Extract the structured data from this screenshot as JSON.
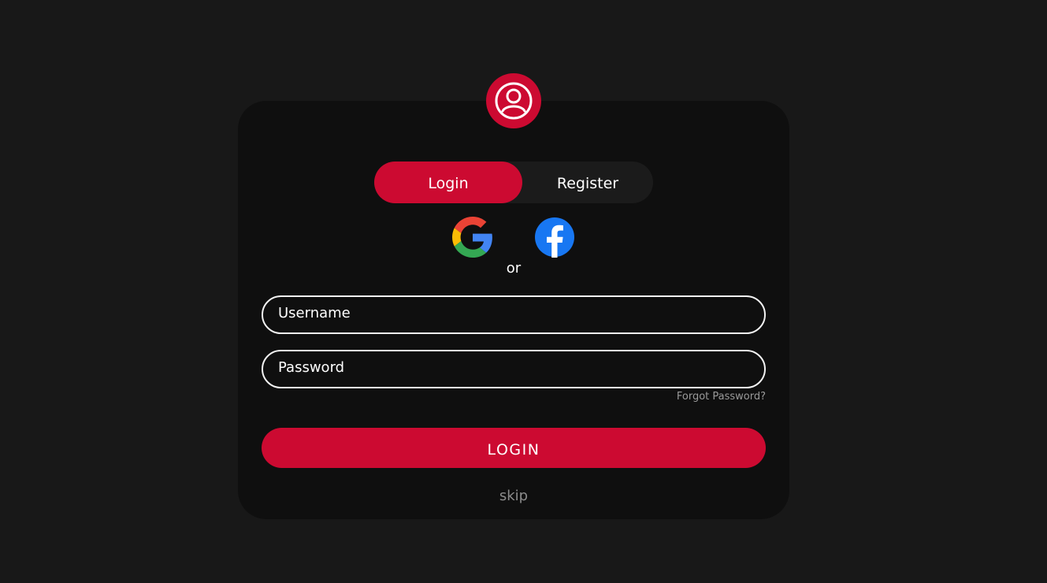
{
  "tabs": {
    "login_label": "Login",
    "register_label": "Register",
    "active": "Login"
  },
  "social": {
    "google_icon": "google-icon",
    "facebook_icon": "facebook-icon"
  },
  "divider_text": "or",
  "form": {
    "username_placeholder": "Username",
    "username_value": "",
    "password_placeholder": "Password",
    "password_value": "",
    "forgot_label": "Forgot Password?",
    "submit_label": "LOGIN",
    "skip_label": "skip"
  },
  "colors": {
    "background": "#181818",
    "card": "#0f0f0f",
    "accent": "#cc0a31",
    "muted_text": "#9a9a9a"
  },
  "icons": {
    "avatar": "user-circle-icon"
  }
}
